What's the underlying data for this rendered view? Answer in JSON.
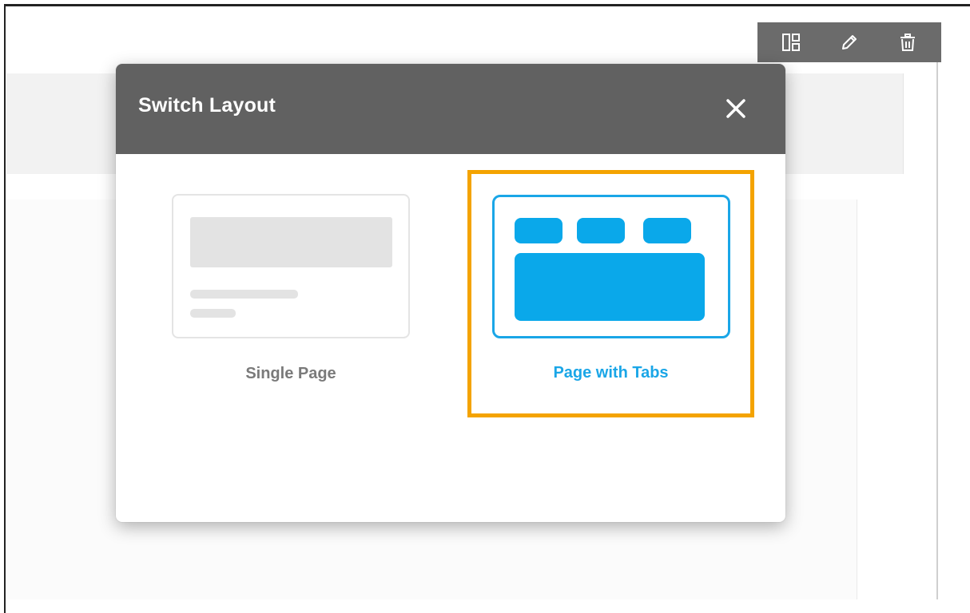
{
  "toolbar": {
    "icons": [
      "layout-icon",
      "pencil-icon",
      "trash-icon"
    ]
  },
  "modal": {
    "title": "Switch Layout",
    "close_icon": "close-icon"
  },
  "options": [
    {
      "label": "Single Page",
      "selected": false
    },
    {
      "label": "Page with Tabs",
      "selected": true
    }
  ],
  "colors": {
    "header_bg": "#616161",
    "toolbar_bg": "#6b6b6b",
    "accent_blue": "#0aa8ea",
    "highlight_orange": "#f4a300",
    "muted_gray_text": "#7a7a7a"
  }
}
